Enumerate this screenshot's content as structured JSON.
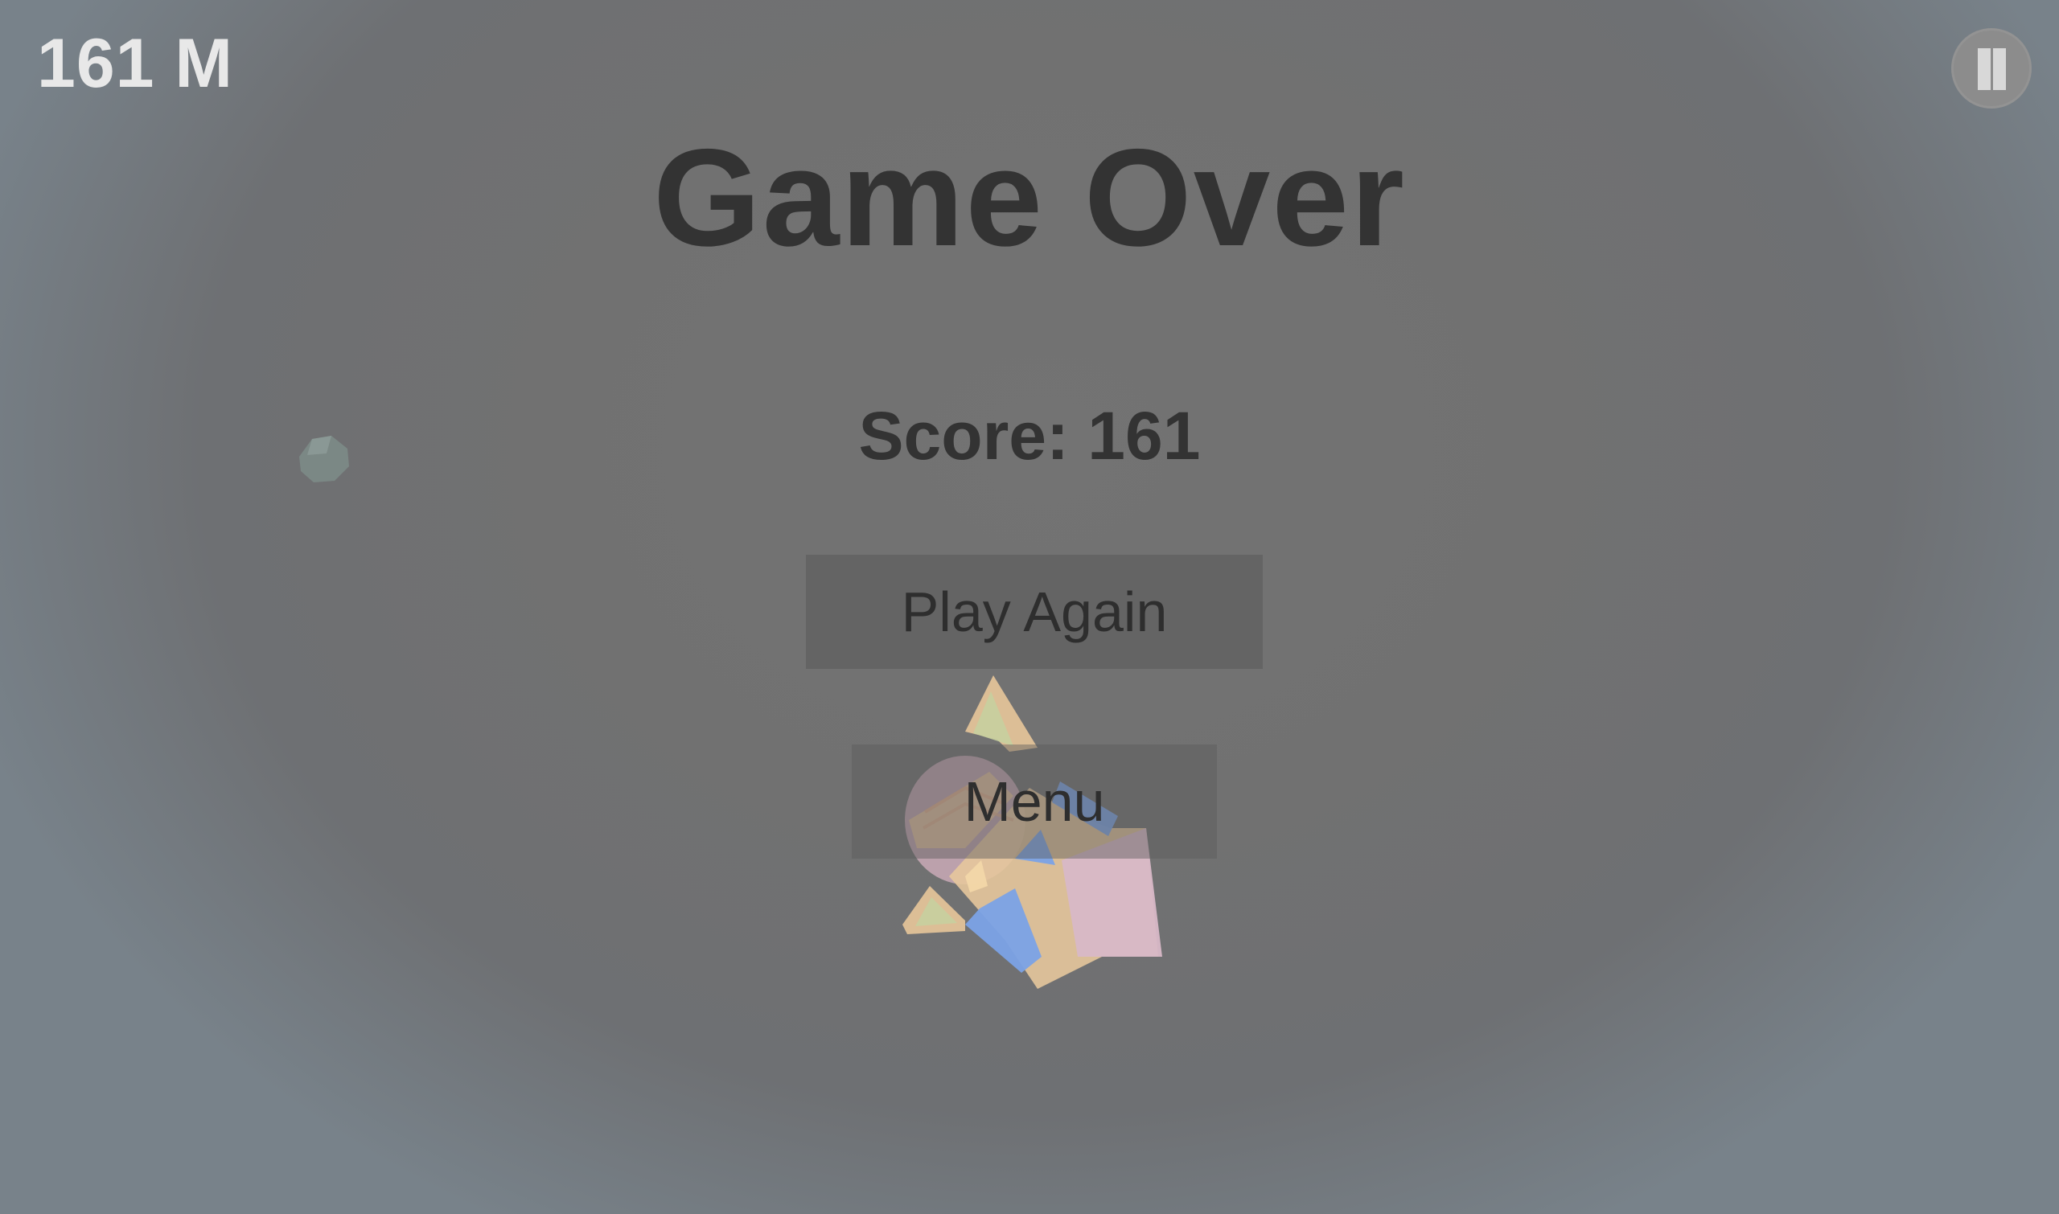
{
  "hud": {
    "distance": "161 M",
    "pause_icon": "pause-icon"
  },
  "game_over": {
    "title": "Game Over",
    "score": "Score: 161",
    "play_again_label": "Play Again",
    "menu_label": "Menu"
  },
  "colors": {
    "background": "#707070",
    "text_dark": "#333333",
    "hud_text": "#e8e8e8",
    "button_bg": "#5f5f5f"
  }
}
